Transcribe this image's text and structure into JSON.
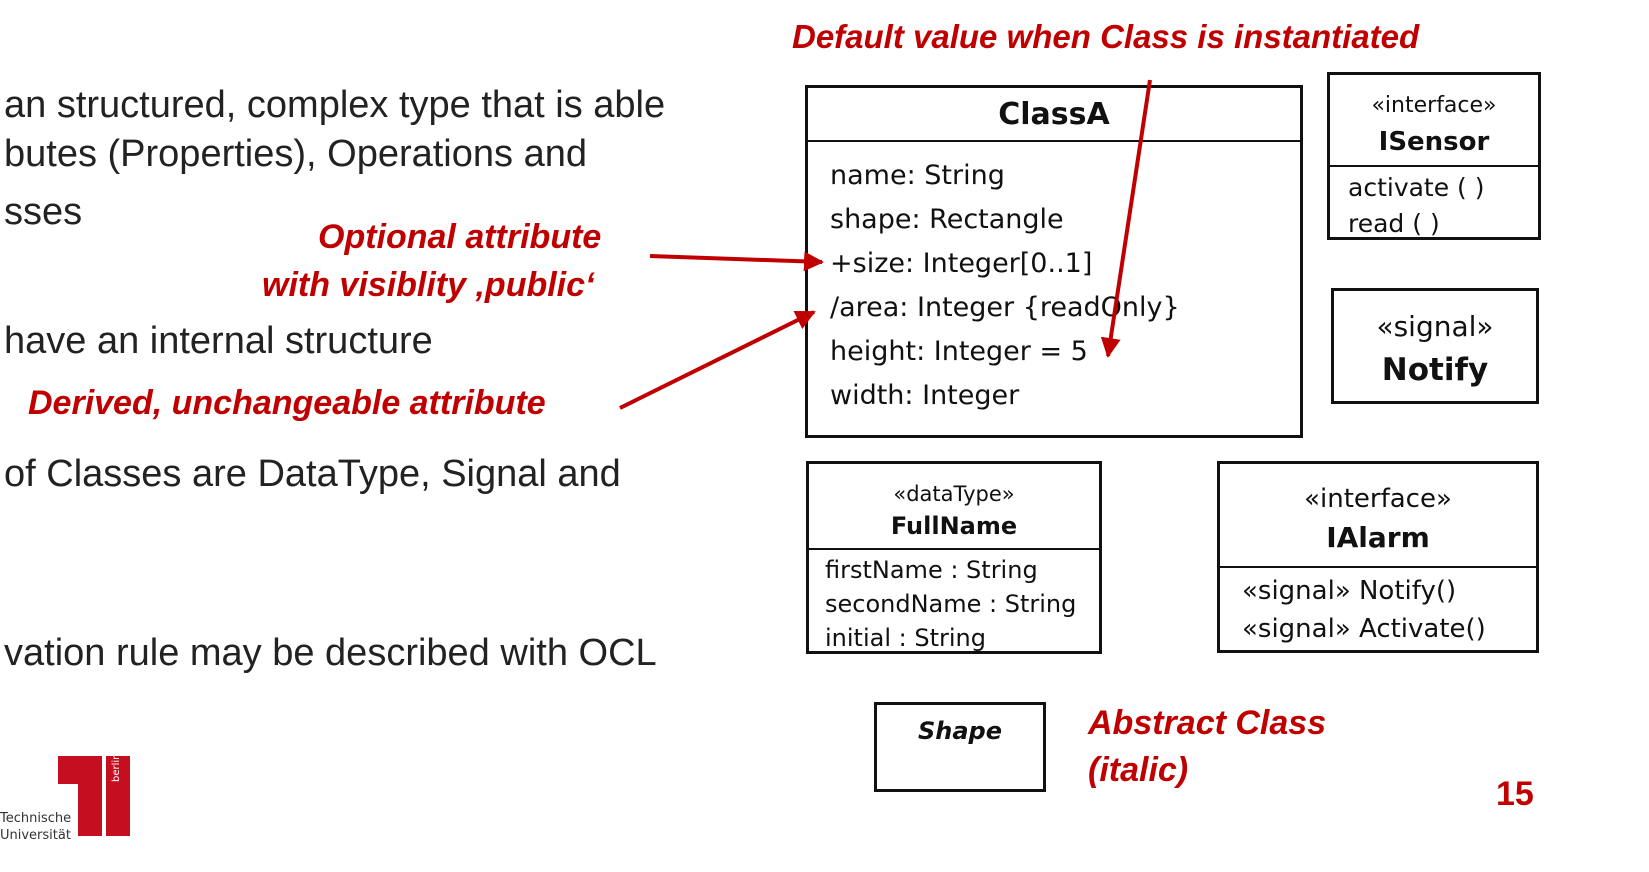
{
  "bullets": [
    "an structured, complex type that is able",
    "butes (Properties), Operations and",
    "sses",
    "have an internal structure",
    "of Classes are DataType, Signal and",
    "vation rule may be described with OCL"
  ],
  "annotations": {
    "default_value": "Default value when Class is instantiated",
    "optional_line1": "Optional attribute",
    "optional_line2": "with visiblity ‚public‘",
    "derived": "Derived, unchangeable attribute",
    "abstract_line1": "Abstract Class",
    "abstract_line2": "(italic)"
  },
  "classA": {
    "name": "ClassA",
    "attributes": [
      "name: String",
      "shape: Rectangle",
      "+size: Integer[0..1]",
      "/area: Integer {readOnly}",
      "height: Integer = 5",
      "width: Integer"
    ]
  },
  "isensor": {
    "stereotype": "«interface»",
    "name": "ISensor",
    "operations": [
      "activate ( )",
      "read ( )"
    ]
  },
  "notify": {
    "stereotype": "«signal»",
    "name": "Notify"
  },
  "fullname": {
    "stereotype": "«dataType»",
    "name": "FullName",
    "attributes": [
      "firstName : String",
      "secondName : String",
      "initial : String"
    ]
  },
  "ialarm": {
    "stereotype": "«interface»",
    "name": "IAlarm",
    "operations": [
      "«signal» Notify()",
      "«signal» Activate()"
    ]
  },
  "shape": {
    "name": "Shape"
  },
  "logo": {
    "line1": "Technische",
    "line2": "Universität",
    "vertical": "berlin"
  },
  "page_number": "15",
  "accent_color": "#c00000"
}
